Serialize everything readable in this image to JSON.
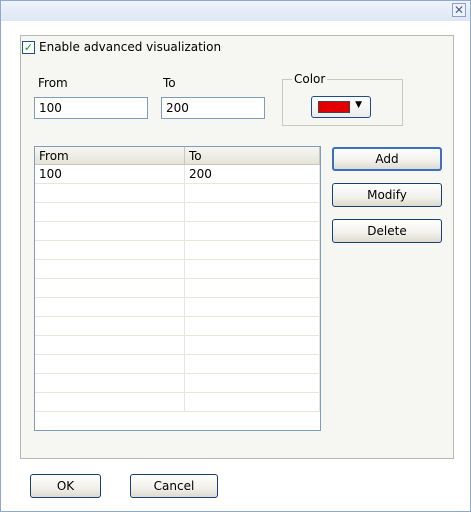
{
  "dialog": {
    "close_glyph": "✕"
  },
  "enable": {
    "label": "Enable advanced visualization",
    "checked": true
  },
  "range": {
    "from_label": "From",
    "to_label": "To",
    "from_value": "100",
    "to_value": "200"
  },
  "color": {
    "legend": "Color",
    "selected": "#e40000",
    "arrow": "▼"
  },
  "table": {
    "columns": [
      "From",
      "To"
    ],
    "rows": [
      [
        "100",
        "200"
      ]
    ]
  },
  "actions": {
    "add": "Add",
    "modify": "Modify",
    "delete": "Delete"
  },
  "footer": {
    "ok": "OK",
    "cancel": "Cancel"
  }
}
